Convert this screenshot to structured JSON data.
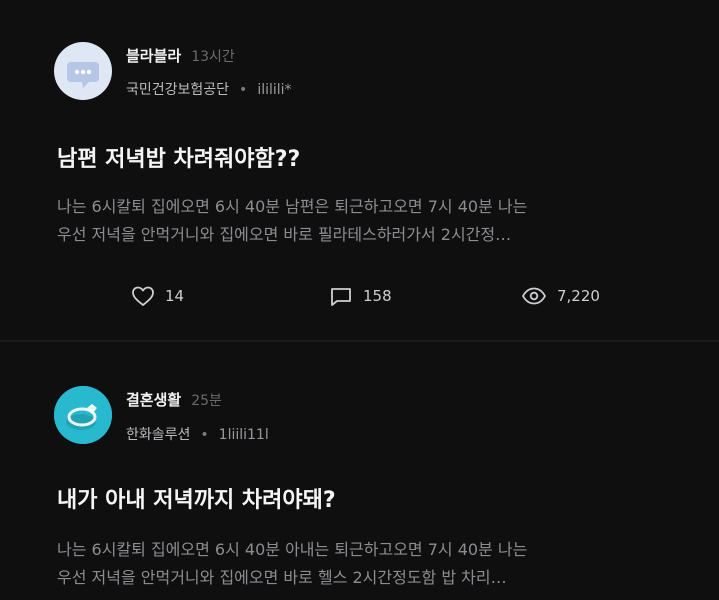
{
  "posts": [
    {
      "author": "블라블라",
      "time": "13시간",
      "company": "국민건강보험공단",
      "separator": "•",
      "handle": "ililili*",
      "title": "남편 저녁밥 차려줘야함??",
      "preview": [
        "나는 6시칼퇴 집에오면 6시 40분  남편은 퇴근하고오면 7시 40분  나는",
        "우선 저녁을 안먹거니와 집에오면 바로  필라테스하러가서 2시간정…"
      ],
      "likes": "14",
      "comments": "158",
      "views": "7,220",
      "avatar_icon": "chat-bubble-icon"
    },
    {
      "author": "결혼생활",
      "time": "25분",
      "company": "한화솔루션",
      "separator": "•",
      "handle": "1liili11l",
      "title": "내가 아내 저녁까지 차려야돼?",
      "preview": [
        "나는 6시칼퇴 집에오면 6시 40분  아내는 퇴근하고오면 7시 40분  나는",
        "우선 저녁을 안먹거니와 집에오면 바로  헬스 2시간정도함  밥 차리…"
      ],
      "avatar_icon": "ring-icon"
    }
  ],
  "colors": {
    "background": "#0f0f10",
    "divider": "#1c1c1e",
    "avatar_1": "#dfe7f4",
    "avatar_2": "#29b9cf"
  }
}
